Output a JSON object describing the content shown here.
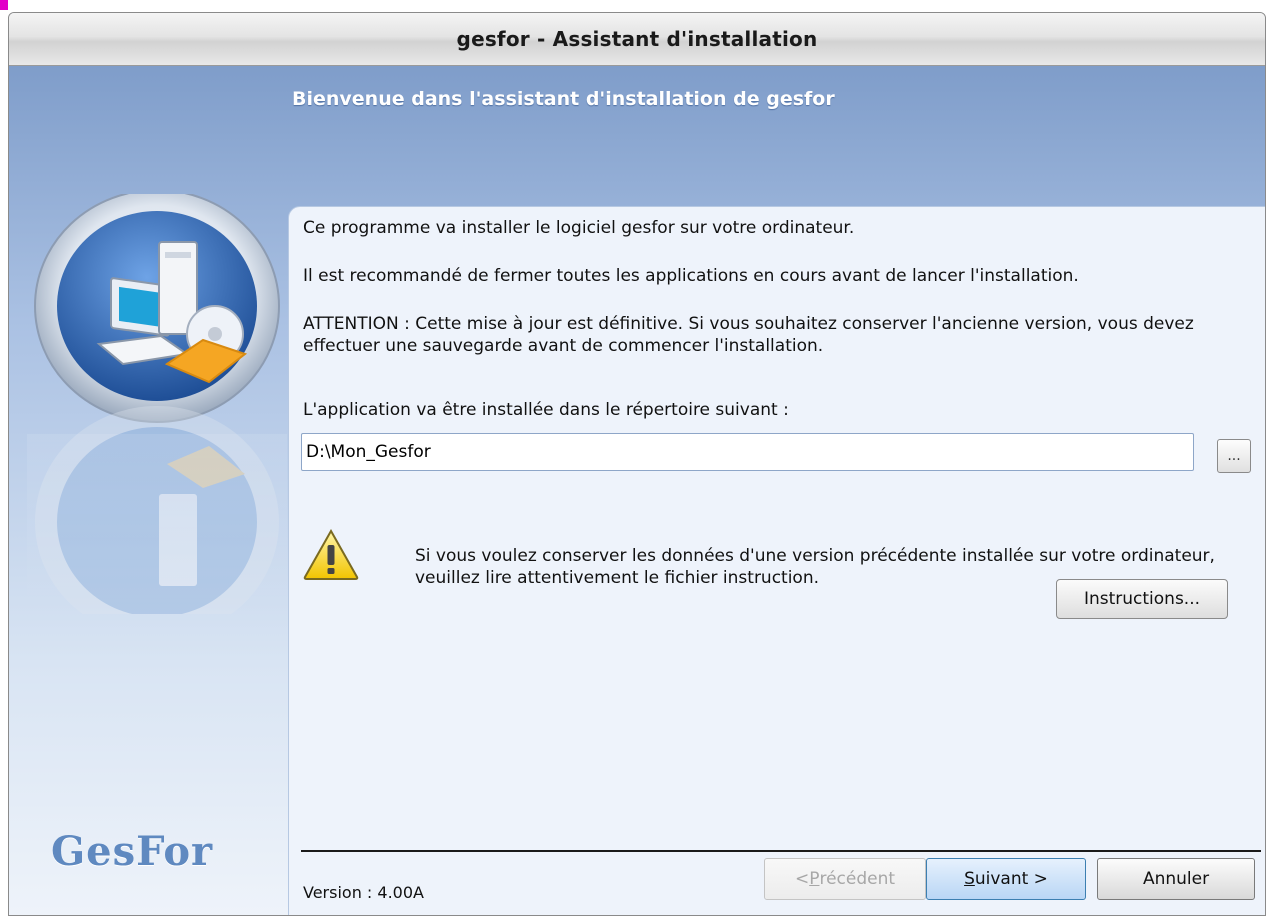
{
  "window": {
    "title": "gesfor - Assistant d'installation"
  },
  "header": {
    "title": "Bienvenue dans l'assistant d'installation de gesfor"
  },
  "sidebar": {
    "brand": "GesFor"
  },
  "main": {
    "intro": "Ce programme va installer le logiciel gesfor sur votre ordinateur.",
    "recommendation": "Il est recommandé de fermer toutes les applications en cours avant de lancer l'installation.",
    "attention": "ATTENTION : Cette mise à jour est définitive. Si vous souhaitez conserver l'ancienne version, vous devez effectuer une sauvegarde avant de commencer l'installation.",
    "directory_label": "L'application va être installée dans le répertoire suivant :",
    "directory_value": "D:\\Mon_Gesfor",
    "browse_label": "...",
    "warning_text": "Si vous voulez conserver les données d'une version précédente installée sur votre ordinateur, veuillez lire attentivement le fichier instruction.",
    "instructions_label": "Instructions..."
  },
  "footer": {
    "version": "Version : 4.00A",
    "prev_prefix": "< ",
    "prev_mnemonic": "P",
    "prev_rest": "récédent",
    "next_mnemonic": "S",
    "next_rest": "uivant >",
    "cancel_label": "Annuler"
  },
  "colors": {
    "accent": "#7f9dca",
    "brand": "#5f89c0",
    "panel": "#eef3fb"
  }
}
